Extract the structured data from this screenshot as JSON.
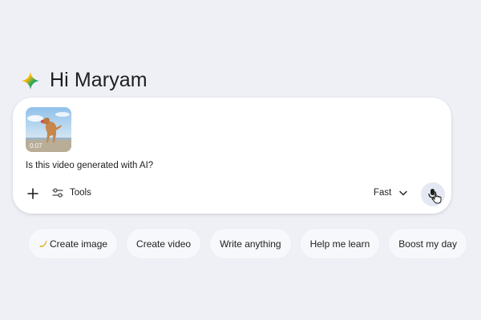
{
  "greeting": {
    "text": "Hi Maryam"
  },
  "composer": {
    "attachment": {
      "duration": "0:07",
      "icon": "video-thumbnail"
    },
    "prompt_text": "Is this video generated with AI?",
    "tools_label": "Tools",
    "model_label": "Fast"
  },
  "chips": [
    {
      "label": "Create image",
      "icon": "banana-icon"
    },
    {
      "label": "Create video"
    },
    {
      "label": "Write anything"
    },
    {
      "label": "Help me learn"
    },
    {
      "label": "Boost my day"
    }
  ],
  "colors": {
    "background": "#eef0f6",
    "card": "#ffffff",
    "chip": "#f7f8fb",
    "mic_button": "#e4e8f2"
  }
}
